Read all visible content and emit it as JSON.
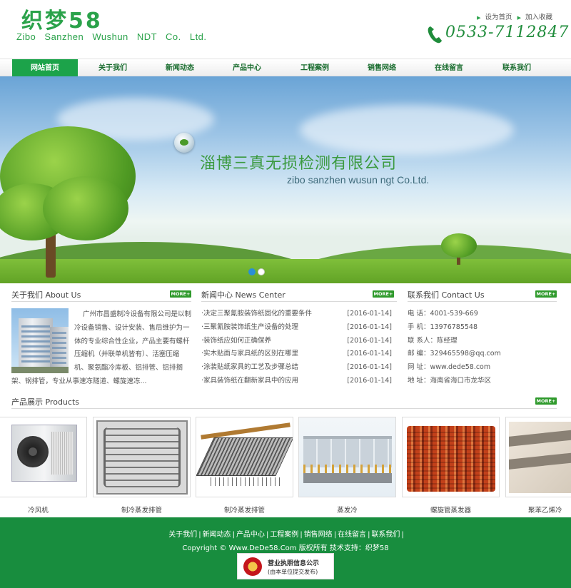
{
  "header": {
    "logo_cn": "织梦58",
    "logo_en": "Zibo Sanzhen Wushun NDT Co. Ltd.",
    "top_links": [
      "设为首页",
      "加入收藏"
    ],
    "phone": "0533-7112847"
  },
  "nav": [
    {
      "label": "网站首页",
      "active": true
    },
    {
      "label": "关于我们",
      "active": false
    },
    {
      "label": "新闻动态",
      "active": false
    },
    {
      "label": "产品中心",
      "active": false
    },
    {
      "label": "工程案例",
      "active": false
    },
    {
      "label": "销售网络",
      "active": false
    },
    {
      "label": "在线留言",
      "active": false
    },
    {
      "label": "联系我们",
      "active": false
    }
  ],
  "banner": {
    "title": "淄博三真无损检测有限公司",
    "subtitle": "zibo sanzhen wusun ngt Co.Ltd.",
    "slides": 2,
    "active_slide": 1
  },
  "more_label": "MORE+",
  "about": {
    "title": "关于我们 About Us",
    "lines": [
      "广州市昌盛制冷设备有限公司是以制",
      "冷设备销售、设计安装、售后维护为一",
      "体的专业综合性企业，产品主要有螺杆",
      "压缩机（并联单机皆有）、活塞压缩",
      "机、聚氨酯冷库板、铝排管、铝排搁",
      "架、钢排管，专业从事速冻隧道、螺旋速冻..."
    ]
  },
  "news": {
    "title": "新闻中心 News Center",
    "items": [
      {
        "title": "·决定三聚氰胺装饰纸固化的重要条件",
        "date": "[2016-01-14]"
      },
      {
        "title": "·三聚氰胺装饰纸生产设备的处理",
        "date": "[2016-01-14]"
      },
      {
        "title": "·装饰纸应如何正确保养",
        "date": "[2016-01-14]"
      },
      {
        "title": "·实木贴面与家具纸的区别在哪里",
        "date": "[2016-01-14]"
      },
      {
        "title": "·涂装贴纸家具的工艺及步骤总结",
        "date": "[2016-01-14]"
      },
      {
        "title": "·家具装饰纸在翻新家具中的应用",
        "date": "[2016-01-14]"
      }
    ]
  },
  "contact": {
    "title": "联系我们 Contact Us",
    "items": [
      "电  话：4001-539-669",
      "手  机：13976785548",
      "联 系人：陈经理",
      "邮  编：329465598@qq.com",
      "网  址：www.dede58.com",
      "地  址：海南省海口市龙华区"
    ]
  },
  "products": {
    "title": "产品展示 Products",
    "items": [
      {
        "name": "冷风机",
        "icon": "cooler-unit"
      },
      {
        "name": "制冷蒸发排管",
        "icon": "evaporator-coil"
      },
      {
        "name": "制冷蒸发排管",
        "icon": "evaporator-rack"
      },
      {
        "name": "蒸发冷",
        "icon": "evaporative-condenser"
      },
      {
        "name": "螺旋管蒸发器",
        "icon": "spiral-evaporator"
      },
      {
        "name": "聚苯乙烯冷",
        "icon": "eps-panel"
      }
    ]
  },
  "footer": {
    "links": [
      "关于我们",
      "新闻动态",
      "产品中心",
      "工程案例",
      "销售网络",
      "在线留言",
      "联系我们"
    ],
    "copyright": "Copyright © Www.DeDe58.Com 版权所有 技术支持：织梦58",
    "license_line1": "营业执照信息公示",
    "license_line2": "(由本单位提交发布)"
  }
}
